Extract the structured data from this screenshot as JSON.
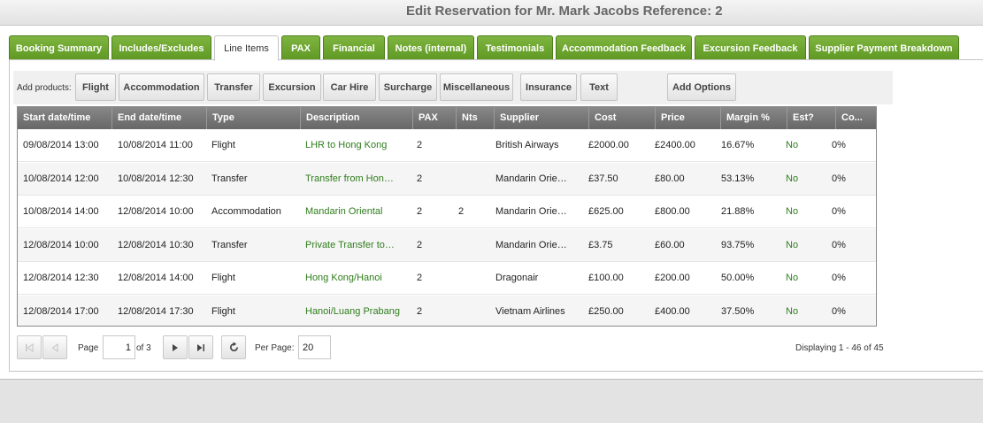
{
  "window": {
    "title": "Edit Reservation for Mr. Mark Jacobs Reference: 2"
  },
  "tabs": [
    {
      "label": "Booking Summary"
    },
    {
      "label": "Includes/Excludes"
    },
    {
      "label": "Line Items",
      "active": true
    },
    {
      "label": "PAX"
    },
    {
      "label": "Financial"
    },
    {
      "label": "Notes (internal)"
    },
    {
      "label": "Testimonials"
    },
    {
      "label": "Accommodation Feedback"
    },
    {
      "label": "Excursion Feedback"
    },
    {
      "label": "Supplier Payment Breakdown"
    }
  ],
  "products": {
    "label": "Add products:",
    "buttons": [
      "Flight",
      "Accommodation",
      "Transfer",
      "Excursion",
      "Car Hire",
      "Surcharge",
      "Miscellaneous",
      "Insurance",
      "Text"
    ],
    "add_options": "Add Options"
  },
  "grid": {
    "columns": [
      "Start date/time",
      "End date/time",
      "Type",
      "Description",
      "PAX",
      "Nts",
      "Supplier",
      "Cost",
      "Price",
      "Margin %",
      "Est?",
      "Co..."
    ],
    "rows": [
      [
        "09/08/2014 13:00",
        "10/08/2014 11:00",
        "Flight",
        "LHR to Hong Kong",
        "2",
        "",
        "British Airways",
        "£2000.00",
        "£2400.00",
        "16.67%",
        "No",
        "0%"
      ],
      [
        "10/08/2014 12:00",
        "10/08/2014 12:30",
        "Transfer",
        "Transfer from Hon…",
        "2",
        "",
        "Mandarin Orie…",
        "£37.50",
        "£80.00",
        "53.13%",
        "No",
        "0%"
      ],
      [
        "10/08/2014 14:00",
        "12/08/2014 10:00",
        "Accommodation",
        "Mandarin Oriental",
        "2",
        "2",
        "Mandarin Orie…",
        "£625.00",
        "£800.00",
        "21.88%",
        "No",
        "0%"
      ],
      [
        "12/08/2014 10:00",
        "12/08/2014 10:30",
        "Transfer",
        "Private Transfer to…",
        "2",
        "",
        "Mandarin Orie…",
        "£3.75",
        "£60.00",
        "93.75%",
        "No",
        "0%"
      ],
      [
        "12/08/2014 12:30",
        "12/08/2014 14:00",
        "Flight",
        "Hong Kong/Hanoi",
        "2",
        "",
        "Dragonair",
        "£100.00",
        "£200.00",
        "50.00%",
        "No",
        "0%"
      ],
      [
        "12/08/2014 17:00",
        "12/08/2014 17:30",
        "Flight",
        "Hanoi/Luang Prabang",
        "2",
        "",
        "Vietnam Airlines",
        "£250.00",
        "£400.00",
        "37.50%",
        "No",
        "0%"
      ]
    ]
  },
  "pager": {
    "page_label": "Page",
    "page_value": "1",
    "of_label": "of 3",
    "per_page_label": "Per Page:",
    "per_page_value": "20",
    "displaying": "Displaying 1 - 46 of 45"
  },
  "colors": {
    "tab_green": "#6aa52d",
    "description_green": "#2e7d1c",
    "header_gray": "#777777"
  },
  "icons": [
    "first-page-icon",
    "prev-page-icon",
    "next-page-icon",
    "last-page-icon",
    "refresh-icon"
  ]
}
